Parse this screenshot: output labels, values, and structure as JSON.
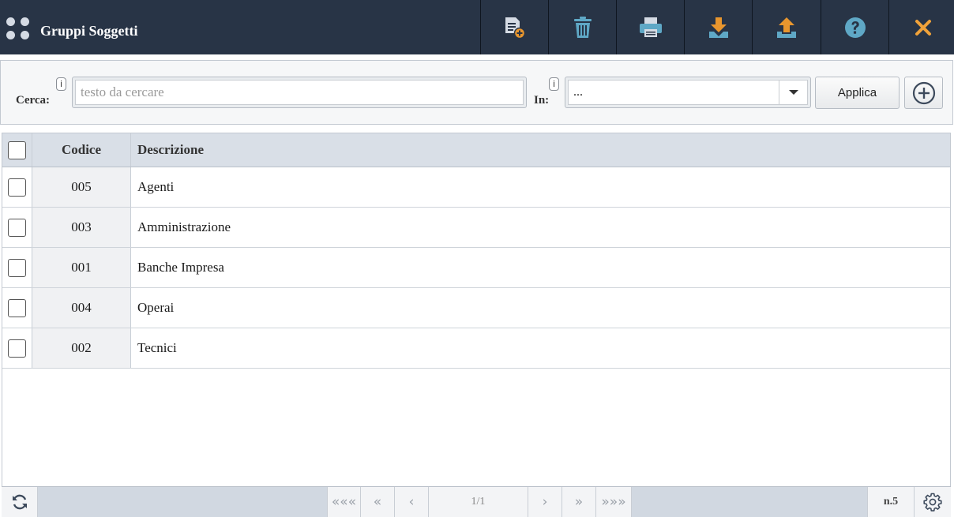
{
  "header": {
    "title": "Gruppi Soggetti",
    "app_icon": "grid-dots-icon",
    "toolbar": [
      {
        "name": "new-document-button",
        "icon": "new-document-icon"
      },
      {
        "name": "delete-button",
        "icon": "trash-icon"
      },
      {
        "name": "print-button",
        "icon": "printer-icon"
      },
      {
        "name": "download-button",
        "icon": "download-icon"
      },
      {
        "name": "upload-button",
        "icon": "upload-icon"
      },
      {
        "name": "help-button",
        "icon": "help-icon"
      },
      {
        "name": "close-button",
        "icon": "close-icon"
      }
    ]
  },
  "search": {
    "label": "Cerca:",
    "info": "i",
    "placeholder": "testo da cercare",
    "value": "",
    "in_label": "In:",
    "in_value": "...",
    "apply_label": "Applica"
  },
  "table": {
    "columns": {
      "code": "Codice",
      "description": "Descrizione"
    },
    "rows": [
      {
        "code": "005",
        "description": "Agenti"
      },
      {
        "code": "003",
        "description": "Amministrazione"
      },
      {
        "code": "001",
        "description": "Banche Impresa"
      },
      {
        "code": "004",
        "description": "Operai"
      },
      {
        "code": "002",
        "description": "Tecnici"
      }
    ]
  },
  "footer": {
    "first": "«««",
    "prev_page": "«",
    "prev": "‹",
    "page": "1/1",
    "next": "›",
    "next_page": "»",
    "last": "»»»",
    "count": "n.5"
  },
  "colors": {
    "header_bg": "#283446",
    "icon_teal": "#5fa8c6",
    "close_orange": "#f0a23a"
  }
}
